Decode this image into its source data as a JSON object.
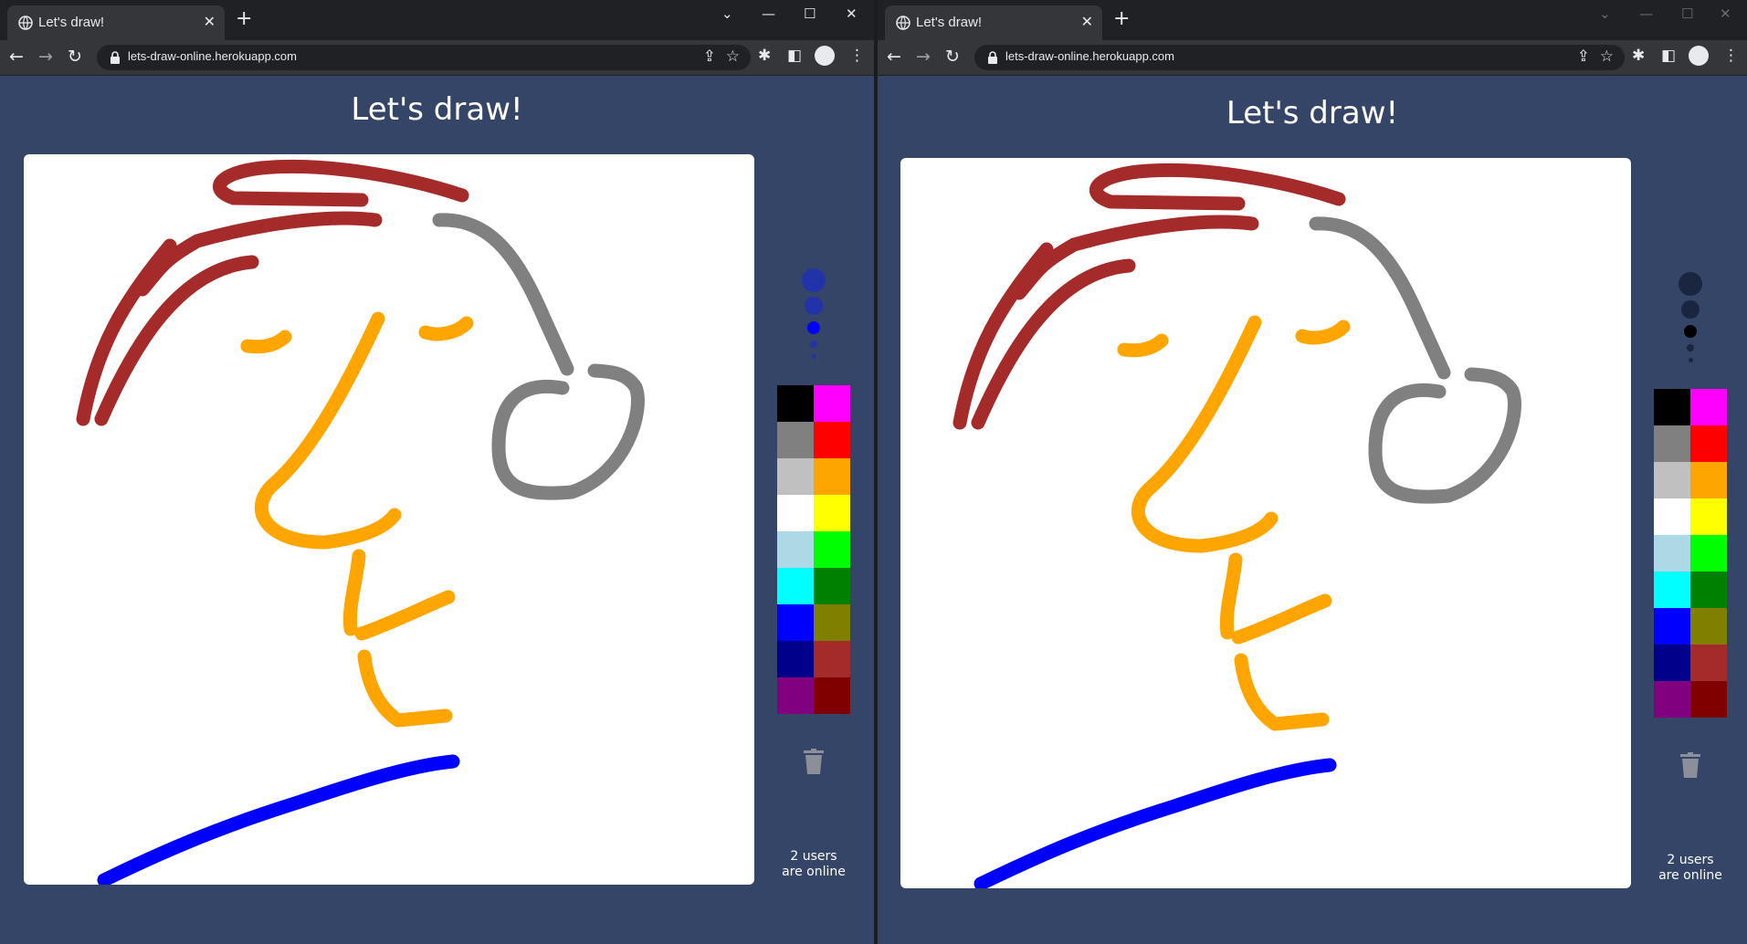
{
  "tab": {
    "title": "Let's draw!",
    "close": "✕",
    "new_tab": "+"
  },
  "window_controls": {
    "chevron": "⌄",
    "minimize": "—",
    "maximize": "☐",
    "close": "✕"
  },
  "nav": {
    "back": "←",
    "forward": "→",
    "reload": "↻"
  },
  "address": {
    "url": "lets-draw-online.herokuapp.com"
  },
  "app": {
    "title": "Let's draw!",
    "online_line1": "2 users",
    "online_line2": "are online"
  },
  "palette": [
    "#000000",
    "#ff00ff",
    "#808080",
    "#ff0000",
    "#c0c0c0",
    "#ffa500",
    "#ffffff",
    "#ffff00",
    "#add8e6",
    "#00ff00",
    "#00ffff",
    "#008000",
    "#0000ff",
    "#808000",
    "#00008b",
    "#a52a2a",
    "#800080",
    "#800000"
  ],
  "brush_color_left": "#2233aa",
  "brush_color_right": "#1a2540",
  "accent": {
    "tab_bg": "#35363a",
    "page_bg": "#344567"
  }
}
